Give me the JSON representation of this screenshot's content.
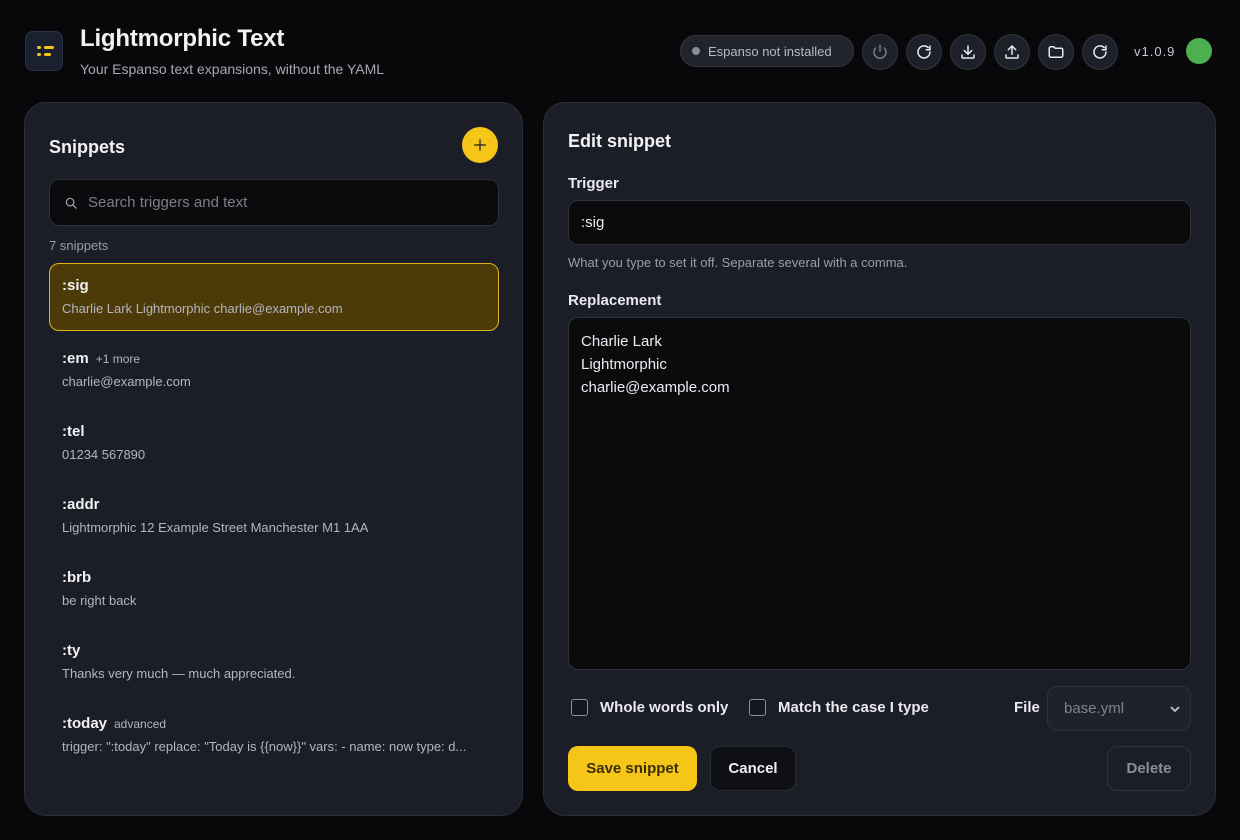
{
  "header": {
    "title": "Lightmorphic Text",
    "subtitle": "Your Espanso text expansions, without the YAML",
    "status": "Espanso not installed",
    "version": "v1.0.9",
    "toolbar_icons": [
      "power-icon",
      "refresh-icon",
      "download-icon",
      "upload-icon",
      "folder-icon",
      "reload-icon"
    ]
  },
  "sidebar": {
    "title": "Snippets",
    "search_placeholder": "Search triggers and text",
    "count": "7 snippets",
    "items": [
      {
        "trigger": ":sig",
        "badge": "",
        "preview": "Charlie Lark Lightmorphic charlie@example.com",
        "selected": true
      },
      {
        "trigger": ":em",
        "badge": "+1 more",
        "preview": "charlie@example.com",
        "selected": false
      },
      {
        "trigger": ":tel",
        "badge": "",
        "preview": "01234 567890",
        "selected": false
      },
      {
        "trigger": ":addr",
        "badge": "",
        "preview": "Lightmorphic 12 Example Street Manchester M1 1AA",
        "selected": false
      },
      {
        "trigger": ":brb",
        "badge": "",
        "preview": "be right back",
        "selected": false
      },
      {
        "trigger": ":ty",
        "badge": "",
        "preview": "Thanks very much — much appreciated.",
        "selected": false
      },
      {
        "trigger": ":today",
        "badge": "advanced",
        "preview": "trigger: \":today\" replace: \"Today is {{now}}\" vars: - name: now type: d...",
        "selected": false
      }
    ]
  },
  "editor": {
    "title": "Edit snippet",
    "trigger_label": "Trigger",
    "trigger_value": ":sig",
    "trigger_hint": "What you type to set it off. Separate several with a comma.",
    "replacement_label": "Replacement",
    "replacement_value": "Charlie Lark\nLightmorphic\ncharlie@example.com",
    "whole_words_label": "Whole words only",
    "match_case_label": "Match the case I type",
    "file_label": "File",
    "file_value": "base.yml",
    "save_label": "Save snippet",
    "cancel_label": "Cancel",
    "delete_label": "Delete"
  },
  "colors": {
    "accent": "#f5c518",
    "background": "#08080a",
    "panel": "#1b1d27",
    "selected_bg": "#4c3a09",
    "connected": "#4caf50"
  }
}
